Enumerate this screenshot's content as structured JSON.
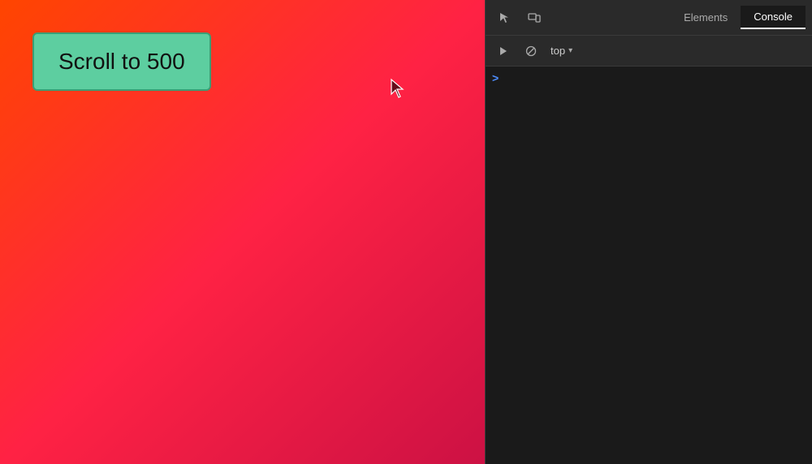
{
  "webpage": {
    "button_label": "Scroll to 500",
    "background_gradient_start": "#ff4500",
    "background_gradient_end": "#cc1133"
  },
  "devtools": {
    "tabs": [
      {
        "id": "elements",
        "label": "Elements",
        "active": false
      },
      {
        "id": "console",
        "label": "Console",
        "active": true
      }
    ],
    "console_toolbar": {
      "context_label": "top"
    },
    "console": {
      "prompt_symbol": ">"
    }
  }
}
